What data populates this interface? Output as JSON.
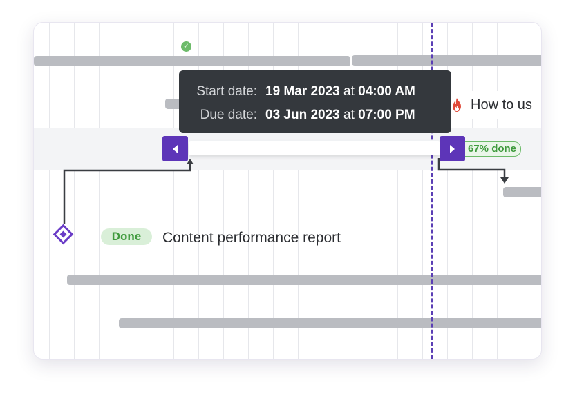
{
  "tooltip": {
    "start_label": "Start date:",
    "start_date": "19 Mar 2023",
    "start_at": "at",
    "start_time": "04:00 AM",
    "due_label": "Due date:",
    "due_date": "03 Jun 2023",
    "due_at": "at",
    "due_time": "07:00 PM"
  },
  "active_task": {
    "progress_label": "67% done",
    "progress_fraction": 0.67
  },
  "right_task": {
    "label": "How to us",
    "icon": "fire-icon"
  },
  "milestone": {
    "status": "Done",
    "label": "Content performance report",
    "icon": "diamond-milestone-icon"
  },
  "colors": {
    "accent": "#5d35b8",
    "today_line": "#5b3fb5",
    "done_green": "#3f9a3d",
    "bar_gray": "#babcc1",
    "tooltip_bg": "#34383d"
  }
}
